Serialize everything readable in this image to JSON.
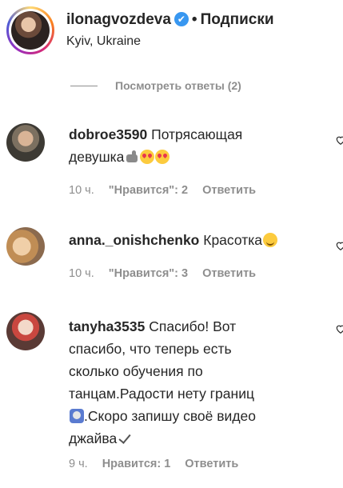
{
  "header": {
    "username": "ilonagvozdeva",
    "verified_glyph": "✔",
    "separator": "•",
    "follow_label": "Подписки",
    "location": "Kyiv, Ukraine"
  },
  "view_replies": {
    "label": "Посмотреть ответы (2)"
  },
  "comments": [
    {
      "username": "dobroe3590",
      "text_line1": "Потрясающая",
      "text_line2": "девушка",
      "emoji_icons": [
        "thumb-icon",
        "heart-eyes-icon",
        "heart-eyes-icon"
      ],
      "time": "10 ч.",
      "likes": "\"Нравится\": 2",
      "reply_label": "Ответить"
    },
    {
      "username": "anna._onishchenko",
      "text": "Красотка",
      "emoji_icons": [
        "smile-icon"
      ],
      "time": "10 ч.",
      "likes": "\"Нравится\": 3",
      "reply_label": "Ответить"
    },
    {
      "username": "tanyha3535",
      "text_line1": "Спасибо! Вот",
      "text_line2": "спасибо, что теперь есть",
      "text_line3": "сколько обучения по",
      "text_line4": "танцам.Радости нету границ",
      "text_line5": ".Скоро запишу своё видео",
      "text_line6": "джайва",
      "emoji_icons": [
        "scream-icon",
        "check-icon"
      ],
      "time": "9 ч.",
      "likes": "Нравится: 1",
      "reply_label": "Ответить"
    }
  ],
  "colors": {
    "text": "#262626",
    "secondary": "#8e8e8e",
    "verified": "#3897f0"
  }
}
